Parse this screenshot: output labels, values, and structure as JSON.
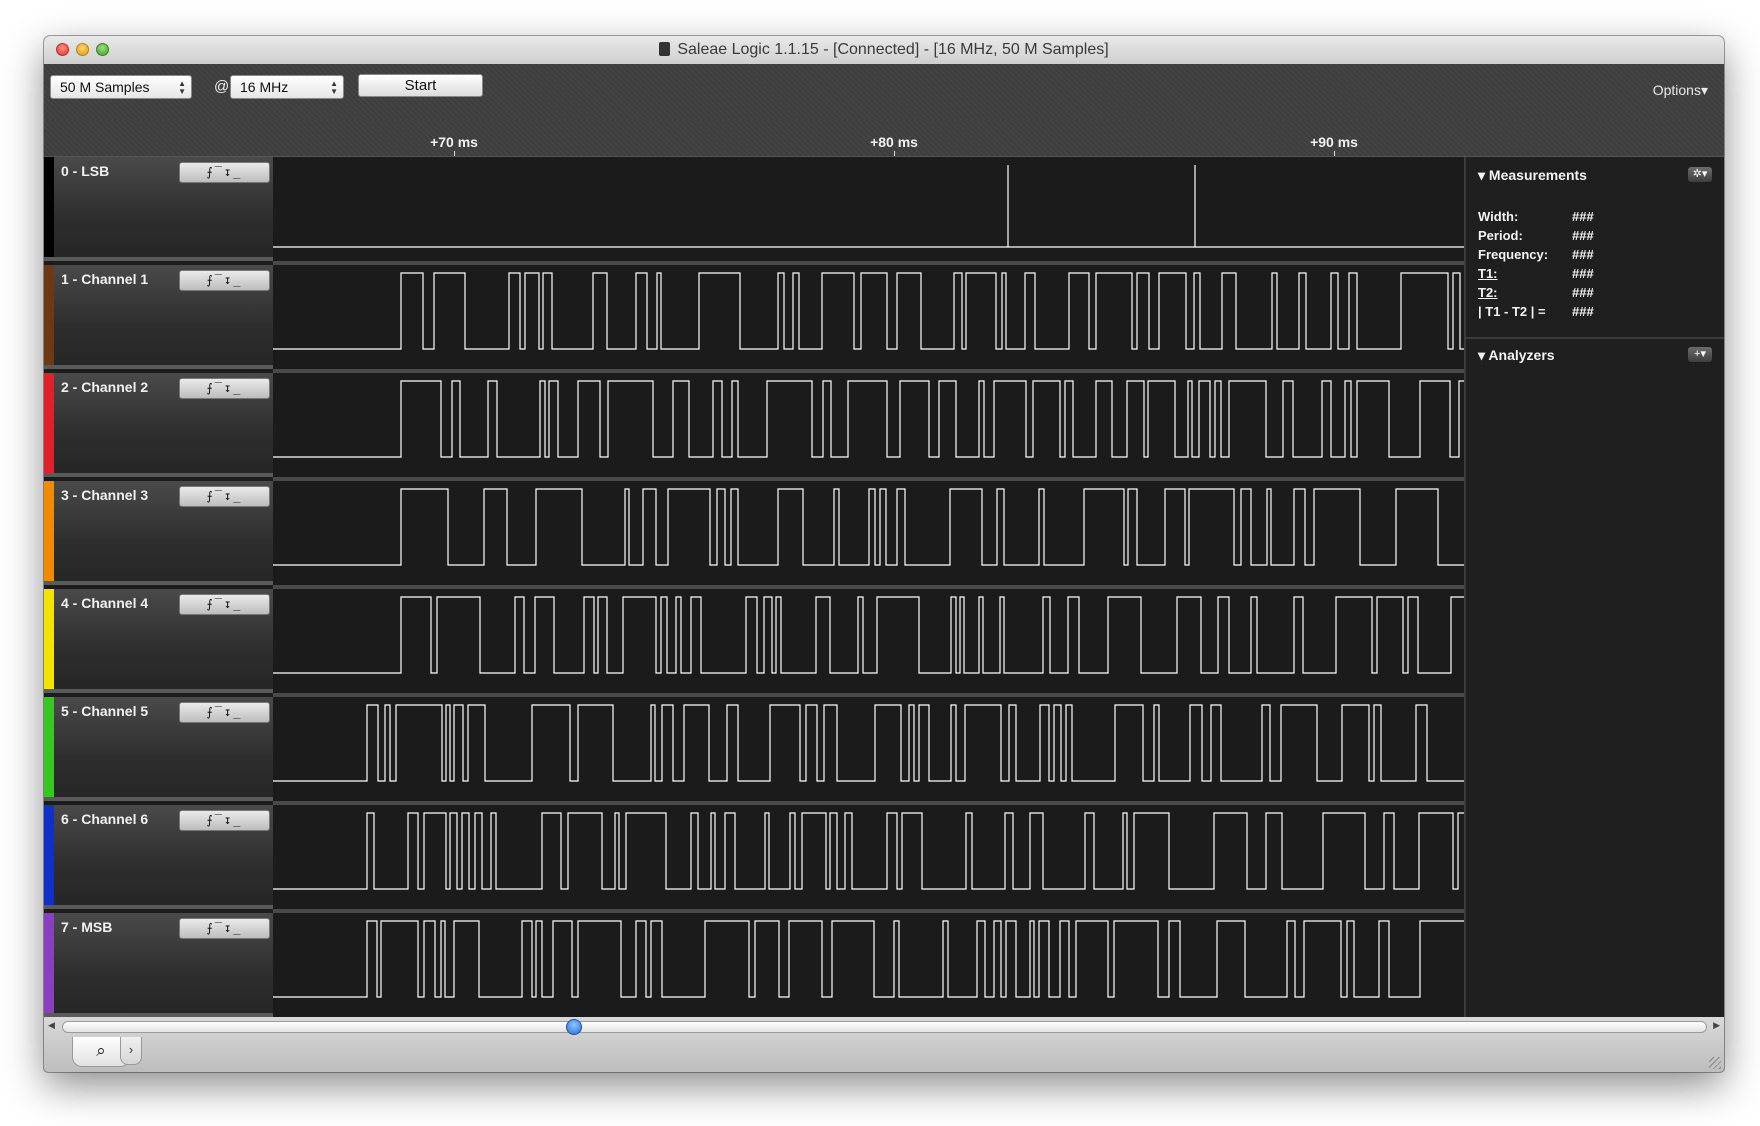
{
  "window": {
    "title": "Saleae Logic 1.1.15 - [Connected] - [16 MHz, 50 M Samples]"
  },
  "toolbar": {
    "samples_value": "50 M Samples",
    "at_symbol": "@",
    "rate_value": "16 MHz",
    "start_label": "Start",
    "options_label": "Options▾"
  },
  "ruler": {
    "ticks": [
      "+70 ms",
      "+80 ms",
      "+90 ms"
    ]
  },
  "channels": [
    {
      "label": "0 - LSB",
      "color": "#000000"
    },
    {
      "label": "1 - Channel 1",
      "color": "#6b3a14"
    },
    {
      "label": "2 - Channel 2",
      "color": "#e0202a"
    },
    {
      "label": "3 - Channel 3",
      "color": "#f08a00"
    },
    {
      "label": "4 - Channel 4",
      "color": "#f2e400"
    },
    {
      "label": "5 - Channel 5",
      "color": "#36c820"
    },
    {
      "label": "6 - Channel 6",
      "color": "#1030c8"
    },
    {
      "label": "7 - MSB",
      "color": "#8a3ec0"
    }
  ],
  "trigger_glyphs": "⨍‾↧_",
  "side": {
    "measurements_title": "Measurements",
    "measurements": [
      {
        "key": "Width:",
        "value": "###"
      },
      {
        "key": "Period:",
        "value": "###"
      },
      {
        "key": "Frequency:",
        "value": "###"
      },
      {
        "key": "T1:",
        "value": "###"
      },
      {
        "key": "T2:",
        "value": "###"
      },
      {
        "key": "| T1 - T2 | =",
        "value": "###"
      }
    ],
    "analyzers_title": "Analyzers"
  },
  "bottom": {
    "search_icon": "magnifier-icon",
    "expand_icon": "chevron-right-icon"
  }
}
